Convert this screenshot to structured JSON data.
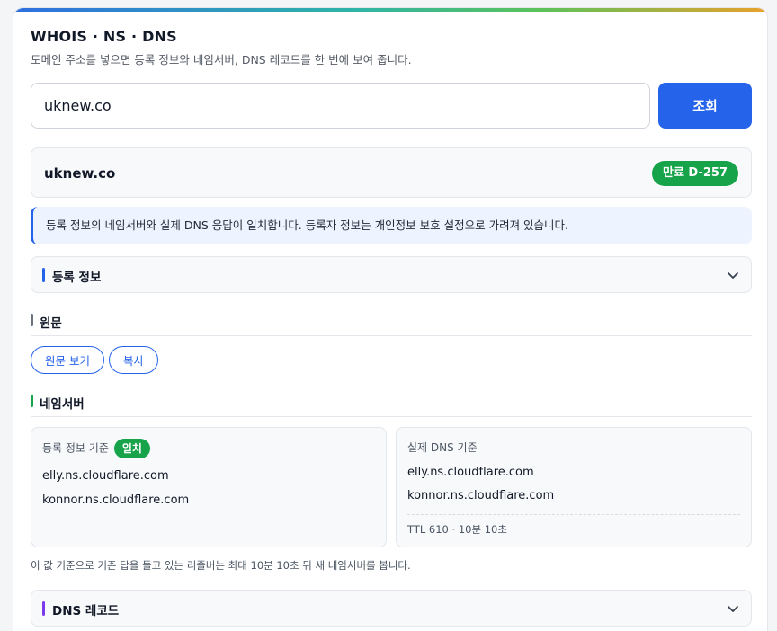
{
  "header": {
    "title": "WHOIS · NS · DNS",
    "subtitle": "도메인 주소를 넣으면 등록 정보와 네임서버, DNS 레코드를 한 번에 보여 줍니다."
  },
  "search": {
    "value": "uknew.co",
    "button_label": "조회"
  },
  "result": {
    "domain": "uknew.co",
    "expiry_badge": "만료 D-257",
    "notice": "등록 정보의 네임서버와 실제 DNS 응답이 일치합니다. 등록자 정보는 개인정보 보호 설정으로 가려져 있습니다."
  },
  "sections": {
    "registration": {
      "label": "등록 정보",
      "accent": "#2563eb"
    },
    "raw": {
      "label": "원문",
      "accent": "#6b7280",
      "view_button": "원문 보기",
      "copy_button": "복사"
    },
    "nameservers": {
      "label": "네임서버",
      "accent": "#16a34a",
      "registry_panel": {
        "title": "등록 정보 기준",
        "badge": "일치",
        "hosts": [
          "elly.ns.cloudflare.com",
          "konnor.ns.cloudflare.com"
        ]
      },
      "dns_panel": {
        "title": "실제 DNS 기준",
        "hosts": [
          "elly.ns.cloudflare.com",
          "konnor.ns.cloudflare.com"
        ],
        "ttl": "TTL 610 · 10분 10초"
      },
      "footnote": "이 값 기준으로 기존 답을 들고 있는 리졸버는 최대 10분 10초 뒤 새 네임서버를 봅니다."
    },
    "dns_records": {
      "label": "DNS 레코드",
      "accent": "#7c3aed"
    }
  },
  "colors": {
    "primary": "#2563eb",
    "success": "#16a34a"
  }
}
